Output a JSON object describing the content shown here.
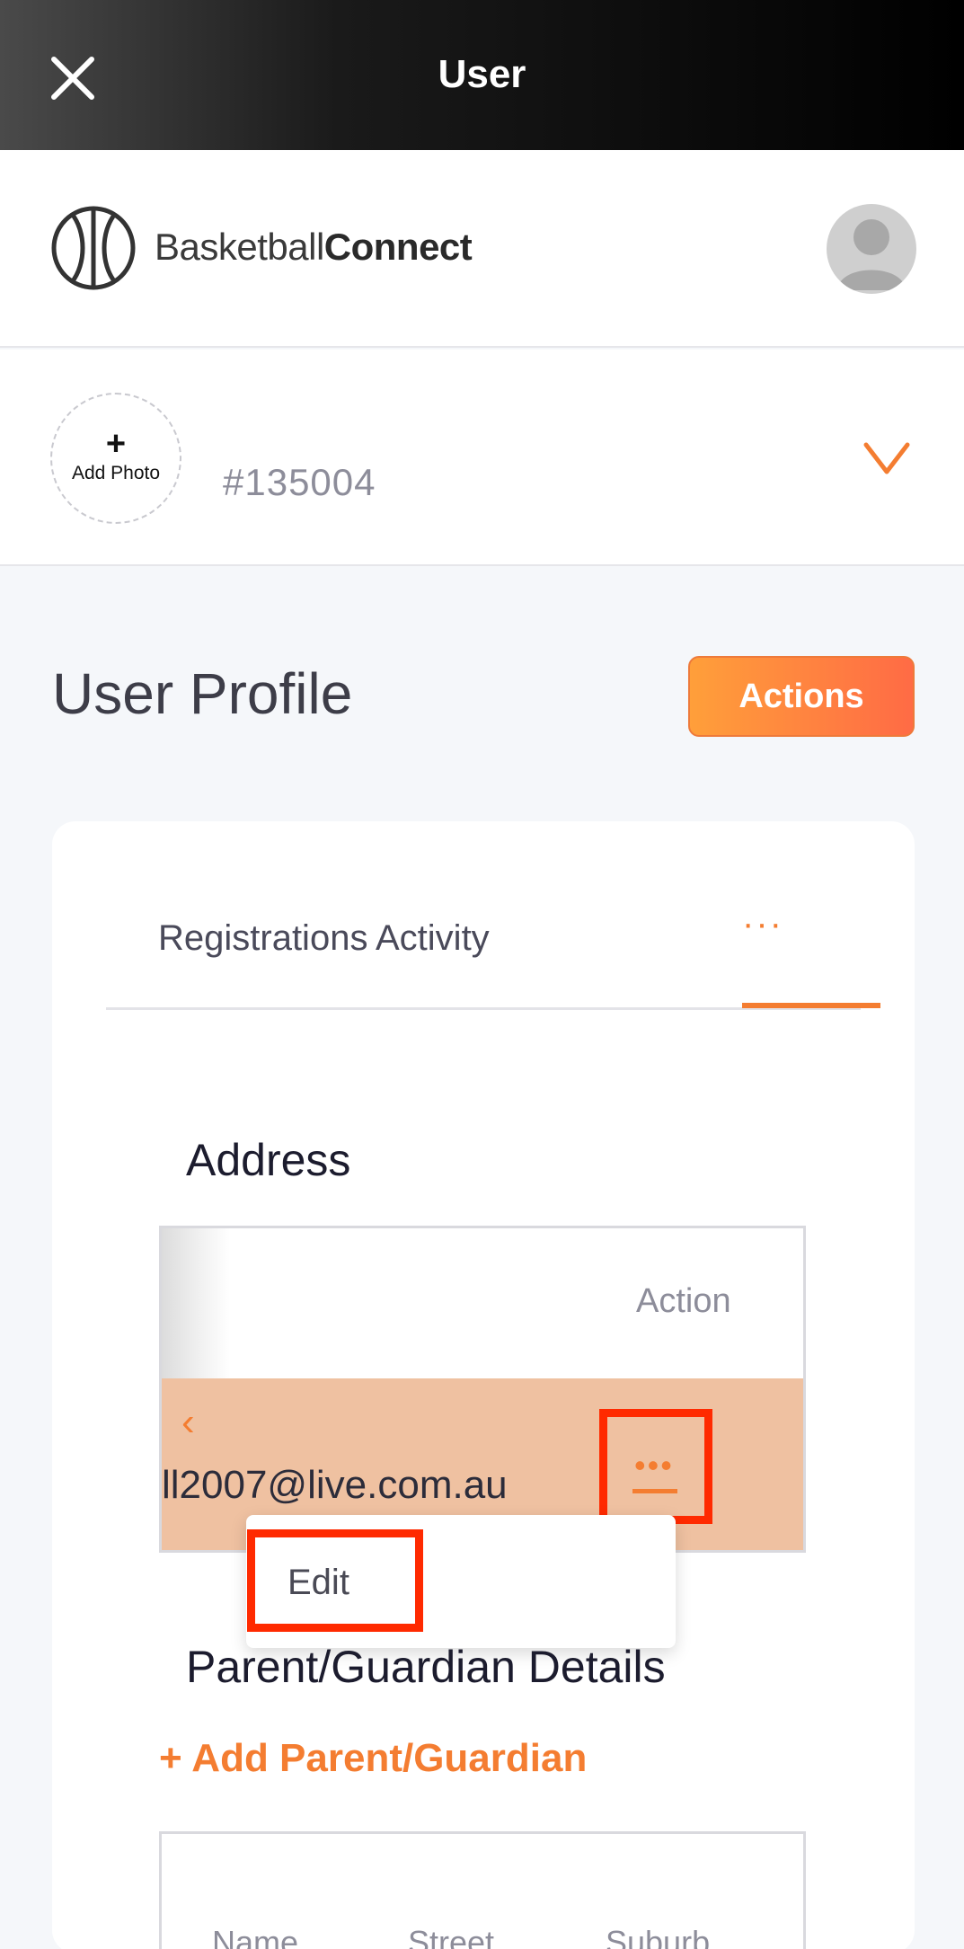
{
  "topbar": {
    "title": "User"
  },
  "brand": {
    "name_light": "Basketball",
    "name_bold": "Connect"
  },
  "user": {
    "add_photo_plus": "+",
    "add_photo_label": "Add Photo",
    "id": "#135004"
  },
  "page": {
    "title": "User Profile",
    "actions_label": "Actions"
  },
  "tabs": [
    {
      "label": "Registrations"
    },
    {
      "label": "Activity"
    },
    {
      "label": "···",
      "active": true
    }
  ],
  "address": {
    "title": "Address",
    "column_action": "Action",
    "row": {
      "email_fragment": "ll2007@live.com.au",
      "menu_dots": "•••"
    },
    "menu": {
      "edit_label": "Edit"
    }
  },
  "parent_guardian": {
    "title": "Parent/Guardian Details",
    "add_label": "+ Add Parent/Guardian",
    "columns": [
      "Name",
      "Street",
      "Suburb"
    ]
  },
  "colors": {
    "accent": "#f47d31",
    "highlight": "#ff2a00",
    "row_selected": "#efc1a1"
  }
}
